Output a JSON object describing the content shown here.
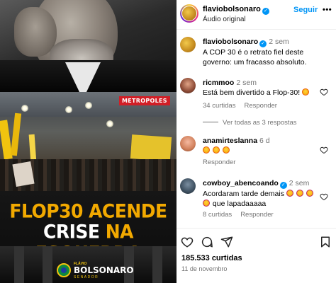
{
  "media": {
    "source_tag": "METROPOLES",
    "headline_line1": "FLOP30 ACENDE",
    "headline_line2_a": "CRISE ",
    "headline_line2_b": "NA ESQUERDA",
    "brand_small": "FLÁVIO",
    "brand_big": "BOLSONARO",
    "brand_sub": "SENADOR"
  },
  "header": {
    "username": "flaviobolsonaro",
    "audio": "Áudio original",
    "follow_label": "Seguir",
    "more": "•••"
  },
  "caption": {
    "username": "flaviobolsonaro",
    "time": "2 sem",
    "text": "A COP 30 é o retrato fiel deste governo: um fracasso absoluto."
  },
  "comments": [
    {
      "username": "ricmmoo",
      "time": "2 sem",
      "text": "Está bem divertido a Flop-30!",
      "likes": "34 curtidas",
      "reply": "Responder",
      "view_replies": "Ver todas as 3 respostas"
    },
    {
      "username": "anamirteslanna",
      "time": "6 d",
      "likes": "",
      "reply": "Responder"
    },
    {
      "username": "cowboy_abencoando",
      "time": "2 sem",
      "text_line1": "Acordaram tarde demais",
      "text_line2": "que lapadaaaaa",
      "likes": "8 curtidas",
      "reply": "Responder"
    }
  ],
  "footer": {
    "likes": "185.533 curtidas",
    "date": "11 de novembro"
  },
  "icons": {
    "like": "heart-icon",
    "comment": "comment-icon",
    "share": "share-icon",
    "save": "bookmark-icon"
  },
  "colors": {
    "accent": "#0095f6",
    "headline_yellow": "#f2a900",
    "meta_gray": "#737373"
  }
}
